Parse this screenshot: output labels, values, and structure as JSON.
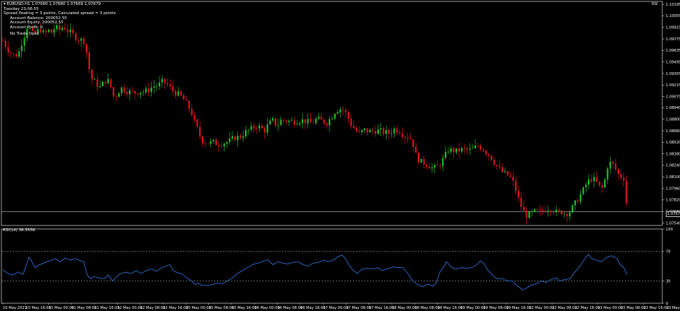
{
  "chart": {
    "symbol_line": "EURUSD,H1  1.07680 1.07680 1.07669 1.07679",
    "day_line": "Tuesday  23:06:55",
    "spread_line": "Spread floating = 3 points, Calculated spread = 3 points",
    "account_balance": "Account Balance: 200052.55",
    "account_equity": "Account Equity: 200052.55",
    "account_profit": "Account Profit: 0",
    "trade_status": "No Trade Open",
    "rsi_tag": "RSI",
    "current_price": "1.07679"
  },
  "colors": {
    "bull": "#22c22a",
    "bear": "#e0141b",
    "rsi": "#2f6fd6",
    "grid": "#ffffff"
  },
  "rsi_panel": {
    "label": "RSI(14) 38.5558"
  },
  "chart_data": [
    {
      "type": "candlestick",
      "title": "EURUSD,H1",
      "y_ticks": [
        "1.10195",
        "1.10055",
        "1.09915",
        "1.09775",
        "1.09635",
        "1.09495",
        "1.09355",
        "1.09215",
        "1.09075",
        "1.08940",
        "1.08800",
        "1.08660",
        "1.08520",
        "1.08380",
        "1.08240",
        "1.08100",
        "1.07960",
        "1.07820",
        "1.07680",
        "1.07540"
      ],
      "ylim": [
        1.0751,
        1.1023
      ],
      "x_tick_labels": [
        "10 May 2023",
        "10 May 16:00",
        "11 May 00:00",
        "11 May 08:00",
        "11 May 16:00",
        "12 May 00:00",
        "12 May 08:00",
        "12 May 16:00",
        "15 May 00:00",
        "15 May 08:00",
        "15 May 16:00",
        "16 May 00:00",
        "16 May 08:00",
        "16 May 16:00",
        "17 May 00:00",
        "17 May 08:00",
        "17 May 16:00",
        "18 May 00:00",
        "18 May 08:00",
        "18 May 16:00",
        "19 May 00:00",
        "19 May 08:00",
        "19 May 16:00",
        "22 May 00:00",
        "22 May 08:00",
        "22 May 16:00",
        "23 May 00:00",
        "23 May 08:00",
        "23 May 16:00",
        "23 May 22:00"
      ],
      "price_line": 1.07679,
      "close_path": [
        [
          0,
          1.0975
        ],
        [
          6,
          1.0965
        ],
        [
          12,
          1.0958
        ],
        [
          18,
          1.0958
        ],
        [
          23,
          1.0975
        ],
        [
          27,
          1.0985
        ],
        [
          30,
          1.0997
        ],
        [
          33,
          1.0985
        ],
        [
          36,
          1.0983
        ],
        [
          40,
          1.0985
        ],
        [
          44,
          1.099
        ],
        [
          49,
          1.0983
        ],
        [
          54,
          1.0988
        ],
        [
          58,
          1.0985
        ],
        [
          62,
          1.0992
        ],
        [
          67,
          1.0988
        ],
        [
          72,
          1.0993
        ],
        [
          76,
          1.0988
        ],
        [
          80,
          1.0985
        ],
        [
          86,
          1.098
        ],
        [
          92,
          1.0976
        ],
        [
          97,
          1.0975
        ],
        [
          101,
          1.095
        ],
        [
          104,
          1.093
        ],
        [
          108,
          1.0926
        ],
        [
          112,
          1.0922
        ],
        [
          116,
          1.0918
        ],
        [
          120,
          1.0926
        ],
        [
          124,
          1.0928
        ],
        [
          128,
          1.0919
        ],
        [
          132,
          1.0905
        ],
        [
          136,
          1.0912
        ],
        [
          140,
          1.0918
        ],
        [
          144,
          1.0916
        ],
        [
          150,
          1.0913
        ],
        [
          156,
          1.0912
        ],
        [
          162,
          1.0914
        ],
        [
          168,
          1.0913
        ],
        [
          173,
          1.0916
        ],
        [
          178,
          1.092
        ],
        [
          184,
          1.0921
        ],
        [
          190,
          1.0926
        ],
        [
          195,
          1.0922
        ],
        [
          200,
          1.0916
        ],
        [
          205,
          1.0912
        ],
        [
          210,
          1.0909
        ],
        [
          215,
          1.0903
        ],
        [
          220,
          1.0895
        ],
        [
          225,
          1.0885
        ],
        [
          228,
          1.0873
        ],
        [
          232,
          1.0865
        ],
        [
          235,
          1.0855
        ],
        [
          240,
          1.0852
        ],
        [
          245,
          1.0851
        ],
        [
          250,
          1.0852
        ],
        [
          255,
          1.085
        ],
        [
          260,
          1.0851
        ],
        [
          265,
          1.0852
        ],
        [
          270,
          1.0854
        ],
        [
          275,
          1.0858
        ],
        [
          280,
          1.0858
        ],
        [
          285,
          1.0862
        ],
        [
          290,
          1.0866
        ],
        [
          295,
          1.0868
        ],
        [
          300,
          1.0872
        ],
        [
          305,
          1.087
        ],
        [
          310,
          1.0866
        ],
        [
          315,
          1.0874
        ],
        [
          320,
          1.0878
        ],
        [
          325,
          1.0872
        ],
        [
          330,
          1.0879
        ],
        [
          336,
          1.0878
        ],
        [
          342,
          1.0877
        ],
        [
          348,
          1.0878
        ],
        [
          354,
          1.0879
        ],
        [
          360,
          1.0877
        ],
        [
          366,
          1.0875
        ],
        [
          372,
          1.088
        ],
        [
          378,
          1.0878
        ],
        [
          384,
          1.0876
        ],
        [
          389,
          1.0882
        ],
        [
          394,
          1.089
        ],
        [
          399,
          1.0893
        ],
        [
          403,
          1.0892
        ],
        [
          408,
          1.0885
        ],
        [
          412,
          1.0875
        ],
        [
          417,
          1.0868
        ],
        [
          422,
          1.0862
        ],
        [
          428,
          1.0867
        ],
        [
          434,
          1.0865
        ],
        [
          440,
          1.0866
        ],
        [
          446,
          1.0866
        ],
        [
          452,
          1.0864
        ],
        [
          458,
          1.0863
        ],
        [
          464,
          1.0868
        ],
        [
          470,
          1.0866
        ],
        [
          476,
          1.086
        ],
        [
          481,
          1.0858
        ],
        [
          485,
          1.0855
        ],
        [
          490,
          1.0835
        ],
        [
          495,
          1.0828
        ],
        [
          500,
          1.0827
        ],
        [
          505,
          1.0824
        ],
        [
          510,
          1.082
        ],
        [
          515,
          1.0822
        ],
        [
          520,
          1.0828
        ],
        [
          524,
          1.0835
        ],
        [
          528,
          1.0843
        ],
        [
          533,
          1.0842
        ],
        [
          538,
          1.0841
        ],
        [
          543,
          1.0843
        ],
        [
          548,
          1.0843
        ],
        [
          553,
          1.0842
        ],
        [
          558,
          1.0844
        ],
        [
          563,
          1.0848
        ],
        [
          568,
          1.0845
        ],
        [
          573,
          1.084
        ],
        [
          578,
          1.0835
        ],
        [
          583,
          1.0827
        ],
        [
          588,
          1.082
        ],
        [
          593,
          1.0815
        ],
        [
          598,
          1.0812
        ],
        [
          603,
          1.0808
        ],
        [
          608,
          1.0794
        ],
        [
          612,
          1.078
        ],
        [
          617,
          1.0768
        ],
        [
          622,
          1.0762
        ],
        [
          627,
          1.0766
        ],
        [
          632,
          1.0768
        ],
        [
          637,
          1.0767
        ],
        [
          642,
          1.077
        ],
        [
          647,
          1.0772
        ],
        [
          652,
          1.0771
        ],
        [
          657,
          1.0766
        ],
        [
          662,
          1.0768
        ],
        [
          667,
          1.0765
        ],
        [
          672,
          1.0768
        ],
        [
          677,
          1.0775
        ],
        [
          682,
          1.0784
        ],
        [
          687,
          1.0792
        ],
        [
          692,
          1.0802
        ],
        [
          697,
          1.0808
        ],
        [
          702,
          1.0806
        ],
        [
          707,
          1.0798
        ],
        [
          712,
          1.0796
        ],
        [
          716,
          1.0822
        ],
        [
          721,
          1.0828
        ],
        [
          726,
          1.082
        ],
        [
          730,
          1.0812
        ],
        [
          734,
          1.081
        ],
        [
          737,
          1.0808
        ],
        [
          740,
          1.0768
        ]
      ]
    },
    {
      "type": "line",
      "title": "RSI(14) 38.5558",
      "y_ticks": [
        "100",
        "70",
        "30",
        "0"
      ],
      "ylim": [
        0,
        100
      ],
      "levels": [
        70,
        30
      ],
      "series": [
        {
          "name": "RSI(14)",
          "points": [
            [
              0,
              45
            ],
            [
              6,
              40
            ],
            [
              12,
              38
            ],
            [
              18,
              42
            ],
            [
              24,
              39
            ],
            [
              28,
              52
            ],
            [
              31,
              62
            ],
            [
              34,
              57
            ],
            [
              38,
              48
            ],
            [
              42,
              51
            ],
            [
              48,
              54
            ],
            [
              55,
              57
            ],
            [
              62,
              60
            ],
            [
              68,
              56
            ],
            [
              74,
              61
            ],
            [
              80,
              58
            ],
            [
              86,
              60
            ],
            [
              92,
              57
            ],
            [
              96,
              56
            ],
            [
              100,
              38
            ],
            [
              104,
              33
            ],
            [
              108,
              36
            ],
            [
              114,
              34
            ],
            [
              120,
              33
            ],
            [
              125,
              38
            ],
            [
              130,
              30
            ],
            [
              135,
              36
            ],
            [
              140,
              40
            ],
            [
              146,
              42
            ],
            [
              152,
              40
            ],
            [
              158,
              44
            ],
            [
              164,
              40
            ],
            [
              170,
              44
            ],
            [
              176,
              46
            ],
            [
              182,
              43
            ],
            [
              188,
              48
            ],
            [
              194,
              50
            ],
            [
              198,
              52
            ],
            [
              202,
              44
            ],
            [
              207,
              41
            ],
            [
              212,
              40
            ],
            [
              218,
              34
            ],
            [
              224,
              30
            ],
            [
              228,
              25
            ],
            [
              232,
              27
            ],
            [
              236,
              24
            ],
            [
              242,
              24
            ],
            [
              248,
              25
            ],
            [
              254,
              27
            ],
            [
              260,
              26
            ],
            [
              266,
              30
            ],
            [
              272,
              34
            ],
            [
              278,
              40
            ],
            [
              284,
              44
            ],
            [
              290,
              48
            ],
            [
              296,
              52
            ],
            [
              302,
              54
            ],
            [
              308,
              56
            ],
            [
              314,
              59
            ],
            [
              320,
              52
            ],
            [
              326,
              56
            ],
            [
              332,
              54
            ],
            [
              338,
              53
            ],
            [
              344,
              55
            ],
            [
              350,
              56
            ],
            [
              356,
              52
            ],
            [
              362,
              50
            ],
            [
              368,
              54
            ],
            [
              374,
              55
            ],
            [
              380,
              58
            ],
            [
              386,
              56
            ],
            [
              392,
              58
            ],
            [
              396,
              62
            ],
            [
              402,
              65
            ],
            [
              406,
              60
            ],
            [
              410,
              52
            ],
            [
              414,
              46
            ],
            [
              420,
              40
            ],
            [
              426,
              46
            ],
            [
              432,
              47
            ],
            [
              438,
              46
            ],
            [
              444,
              48
            ],
            [
              450,
              44
            ],
            [
              456,
              46
            ],
            [
              462,
              49
            ],
            [
              468,
              48
            ],
            [
              474,
              48
            ],
            [
              480,
              40
            ],
            [
              486,
              30
            ],
            [
              492,
              25
            ],
            [
              498,
              22
            ],
            [
              504,
              26
            ],
            [
              510,
              23
            ],
            [
              514,
              28
            ],
            [
              518,
              42
            ],
            [
              522,
              48
            ],
            [
              526,
              56
            ],
            [
              532,
              48
            ],
            [
              538,
              46
            ],
            [
              544,
              48
            ],
            [
              550,
              47
            ],
            [
              556,
              48
            ],
            [
              562,
              52
            ],
            [
              566,
              57
            ],
            [
              570,
              54
            ],
            [
              574,
              46
            ],
            [
              580,
              38
            ],
            [
              586,
              33
            ],
            [
              592,
              33
            ],
            [
              598,
              30
            ],
            [
              604,
              30
            ],
            [
              608,
              25
            ],
            [
              612,
              22
            ],
            [
              616,
              18
            ],
            [
              620,
              20
            ],
            [
              626,
              24
            ],
            [
              632,
              26
            ],
            [
              638,
              30
            ],
            [
              644,
              28
            ],
            [
              650,
              32
            ],
            [
              656,
              34
            ],
            [
              660,
              30
            ],
            [
              666,
              32
            ],
            [
              672,
              33
            ],
            [
              678,
              42
            ],
            [
              684,
              50
            ],
            [
              690,
              60
            ],
            [
              694,
              66
            ],
            [
              698,
              60
            ],
            [
              704,
              58
            ],
            [
              710,
              56
            ],
            [
              716,
              62
            ],
            [
              722,
              64
            ],
            [
              728,
              60
            ],
            [
              732,
              52
            ],
            [
              736,
              48
            ],
            [
              740,
              38
            ]
          ]
        }
      ]
    }
  ]
}
